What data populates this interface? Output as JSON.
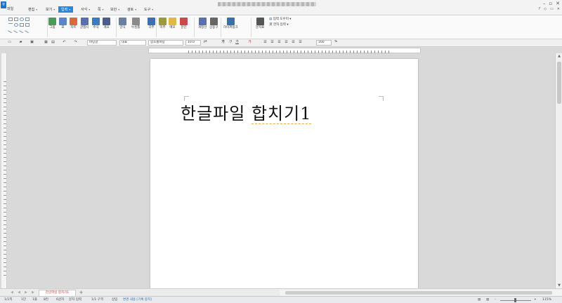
{
  "menubar": {
    "items": [
      {
        "label": "파일",
        "dropdown": false
      },
      {
        "label": "편집",
        "dropdown": true
      },
      {
        "label": "보기",
        "dropdown": true
      },
      {
        "label": "입력",
        "dropdown": true,
        "active": true
      },
      {
        "label": "서식",
        "dropdown": true
      },
      {
        "label": "쪽",
        "dropdown": true
      },
      {
        "label": "보안",
        "dropdown": true
      },
      {
        "label": "검토",
        "dropdown": true
      },
      {
        "label": "도구",
        "dropdown": true
      }
    ],
    "right_controls": [
      "?",
      "◇",
      "▭",
      "✕"
    ]
  },
  "ribbon": {
    "buttons": [
      {
        "label": "그림",
        "color": "#4a9a5a"
      },
      {
        "label": "표",
        "color": "#5b85c5"
      },
      {
        "label": "차트",
        "color": "#d96a3b"
      },
      {
        "label": "글맵시",
        "color": "#5b6fb0"
      },
      {
        "label": "수식",
        "color": "#3c7ac1"
      },
      {
        "label": "개요",
        "color": "#4b5d8a"
      },
      {
        "label": "양식",
        "color": "#6b7fa0"
      },
      {
        "label": "누름틀",
        "color": "#8a8a8a"
      },
      {
        "label": "각주",
        "color": "#3f6fb0"
      },
      {
        "label": "미주",
        "color": "#9a9a40"
      },
      {
        "label": "메모",
        "color": "#e0b84a"
      },
      {
        "label": "문단",
        "color": "#c94a4a"
      },
      {
        "label": "개정선",
        "color": "#5b6fb0"
      },
      {
        "label": "상용구",
        "color": "#666666"
      },
      {
        "label": "하이퍼링크",
        "color": "#3d6ea8"
      },
      {
        "label": "문자표",
        "color": "#555555"
      }
    ],
    "small_items": [
      "입력 도우미",
      "한자 입력"
    ]
  },
  "toolbar": {
    "style": "바탕글",
    "lang": "대표",
    "font": "함초롬바탕",
    "size": "10.0",
    "unit": "pt",
    "zoom": "160",
    "zoom_unit": "%"
  },
  "document": {
    "text_part1": "한글파일 ",
    "text_part2": "합치기1"
  },
  "tabs": {
    "doc_tab": "한글파일 합치기1",
    "add": "+"
  },
  "statusbar": {
    "items": [
      "1/1쪽",
      "1단",
      "1줄",
      "8칸",
      "6글자",
      "문자 입력",
      "1/1 구역",
      "삽입"
    ],
    "mode": "변경 내용 [기록 중지]",
    "zoom": "115%"
  },
  "colors": {
    "accent": "#2b86d9",
    "tab_text": "#c0392b"
  }
}
